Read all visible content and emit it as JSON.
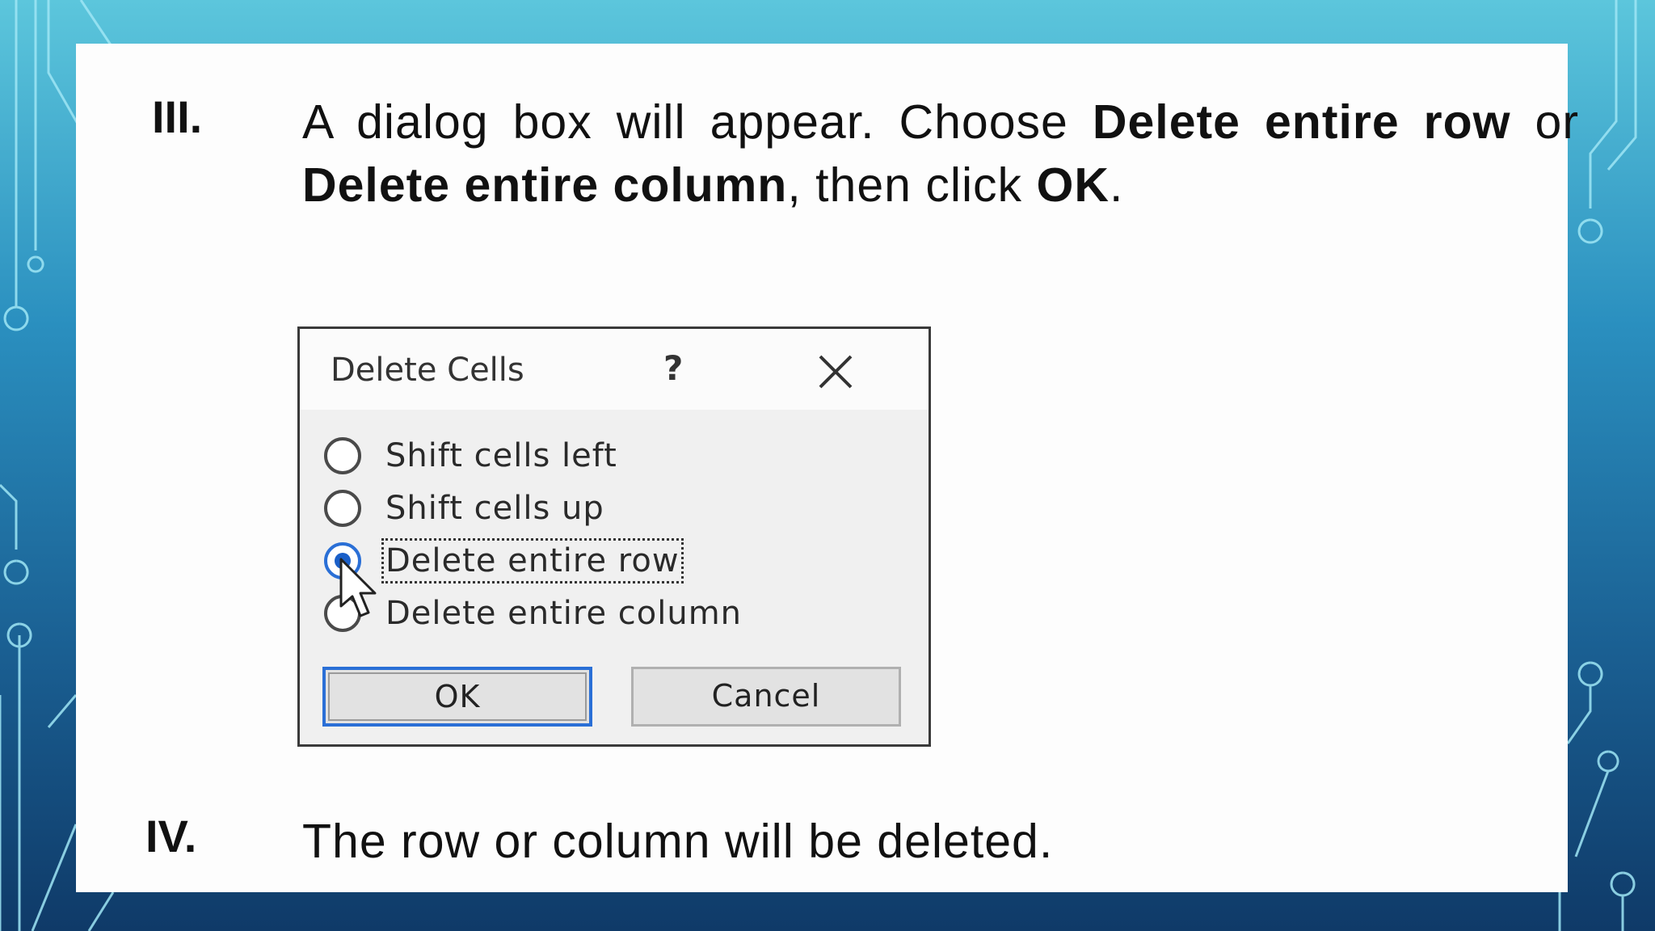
{
  "steps": [
    {
      "numeral": "III.",
      "parts": [
        {
          "text": "A dialog box will appear. Choose ",
          "bold": false
        },
        {
          "text": "Delete entire row",
          "bold": true
        },
        {
          "text": " or ",
          "bold": false
        },
        {
          "text": "Delete entire column",
          "bold": true
        },
        {
          "text": ", then click ",
          "bold": false
        },
        {
          "text": "OK",
          "bold": true
        },
        {
          "text": ".",
          "bold": false
        }
      ]
    },
    {
      "numeral": "IV.",
      "parts": [
        {
          "text": "The row or column will be deleted.",
          "bold": false
        }
      ]
    }
  ],
  "dialog": {
    "title": "Delete Cells",
    "help": "?",
    "close_icon": "close-icon",
    "options": [
      {
        "label": "Shift cells left",
        "selected": false
      },
      {
        "label": "Shift cells up",
        "selected": false
      },
      {
        "label": "Delete entire row",
        "selected": true
      },
      {
        "label": "Delete entire column",
        "selected": false
      }
    ],
    "ok_label": "OK",
    "cancel_label": "Cancel"
  },
  "colors": {
    "background_top": "#5cc6dc",
    "background_bottom": "#0f3a68",
    "accent": "#2a6fd6"
  }
}
